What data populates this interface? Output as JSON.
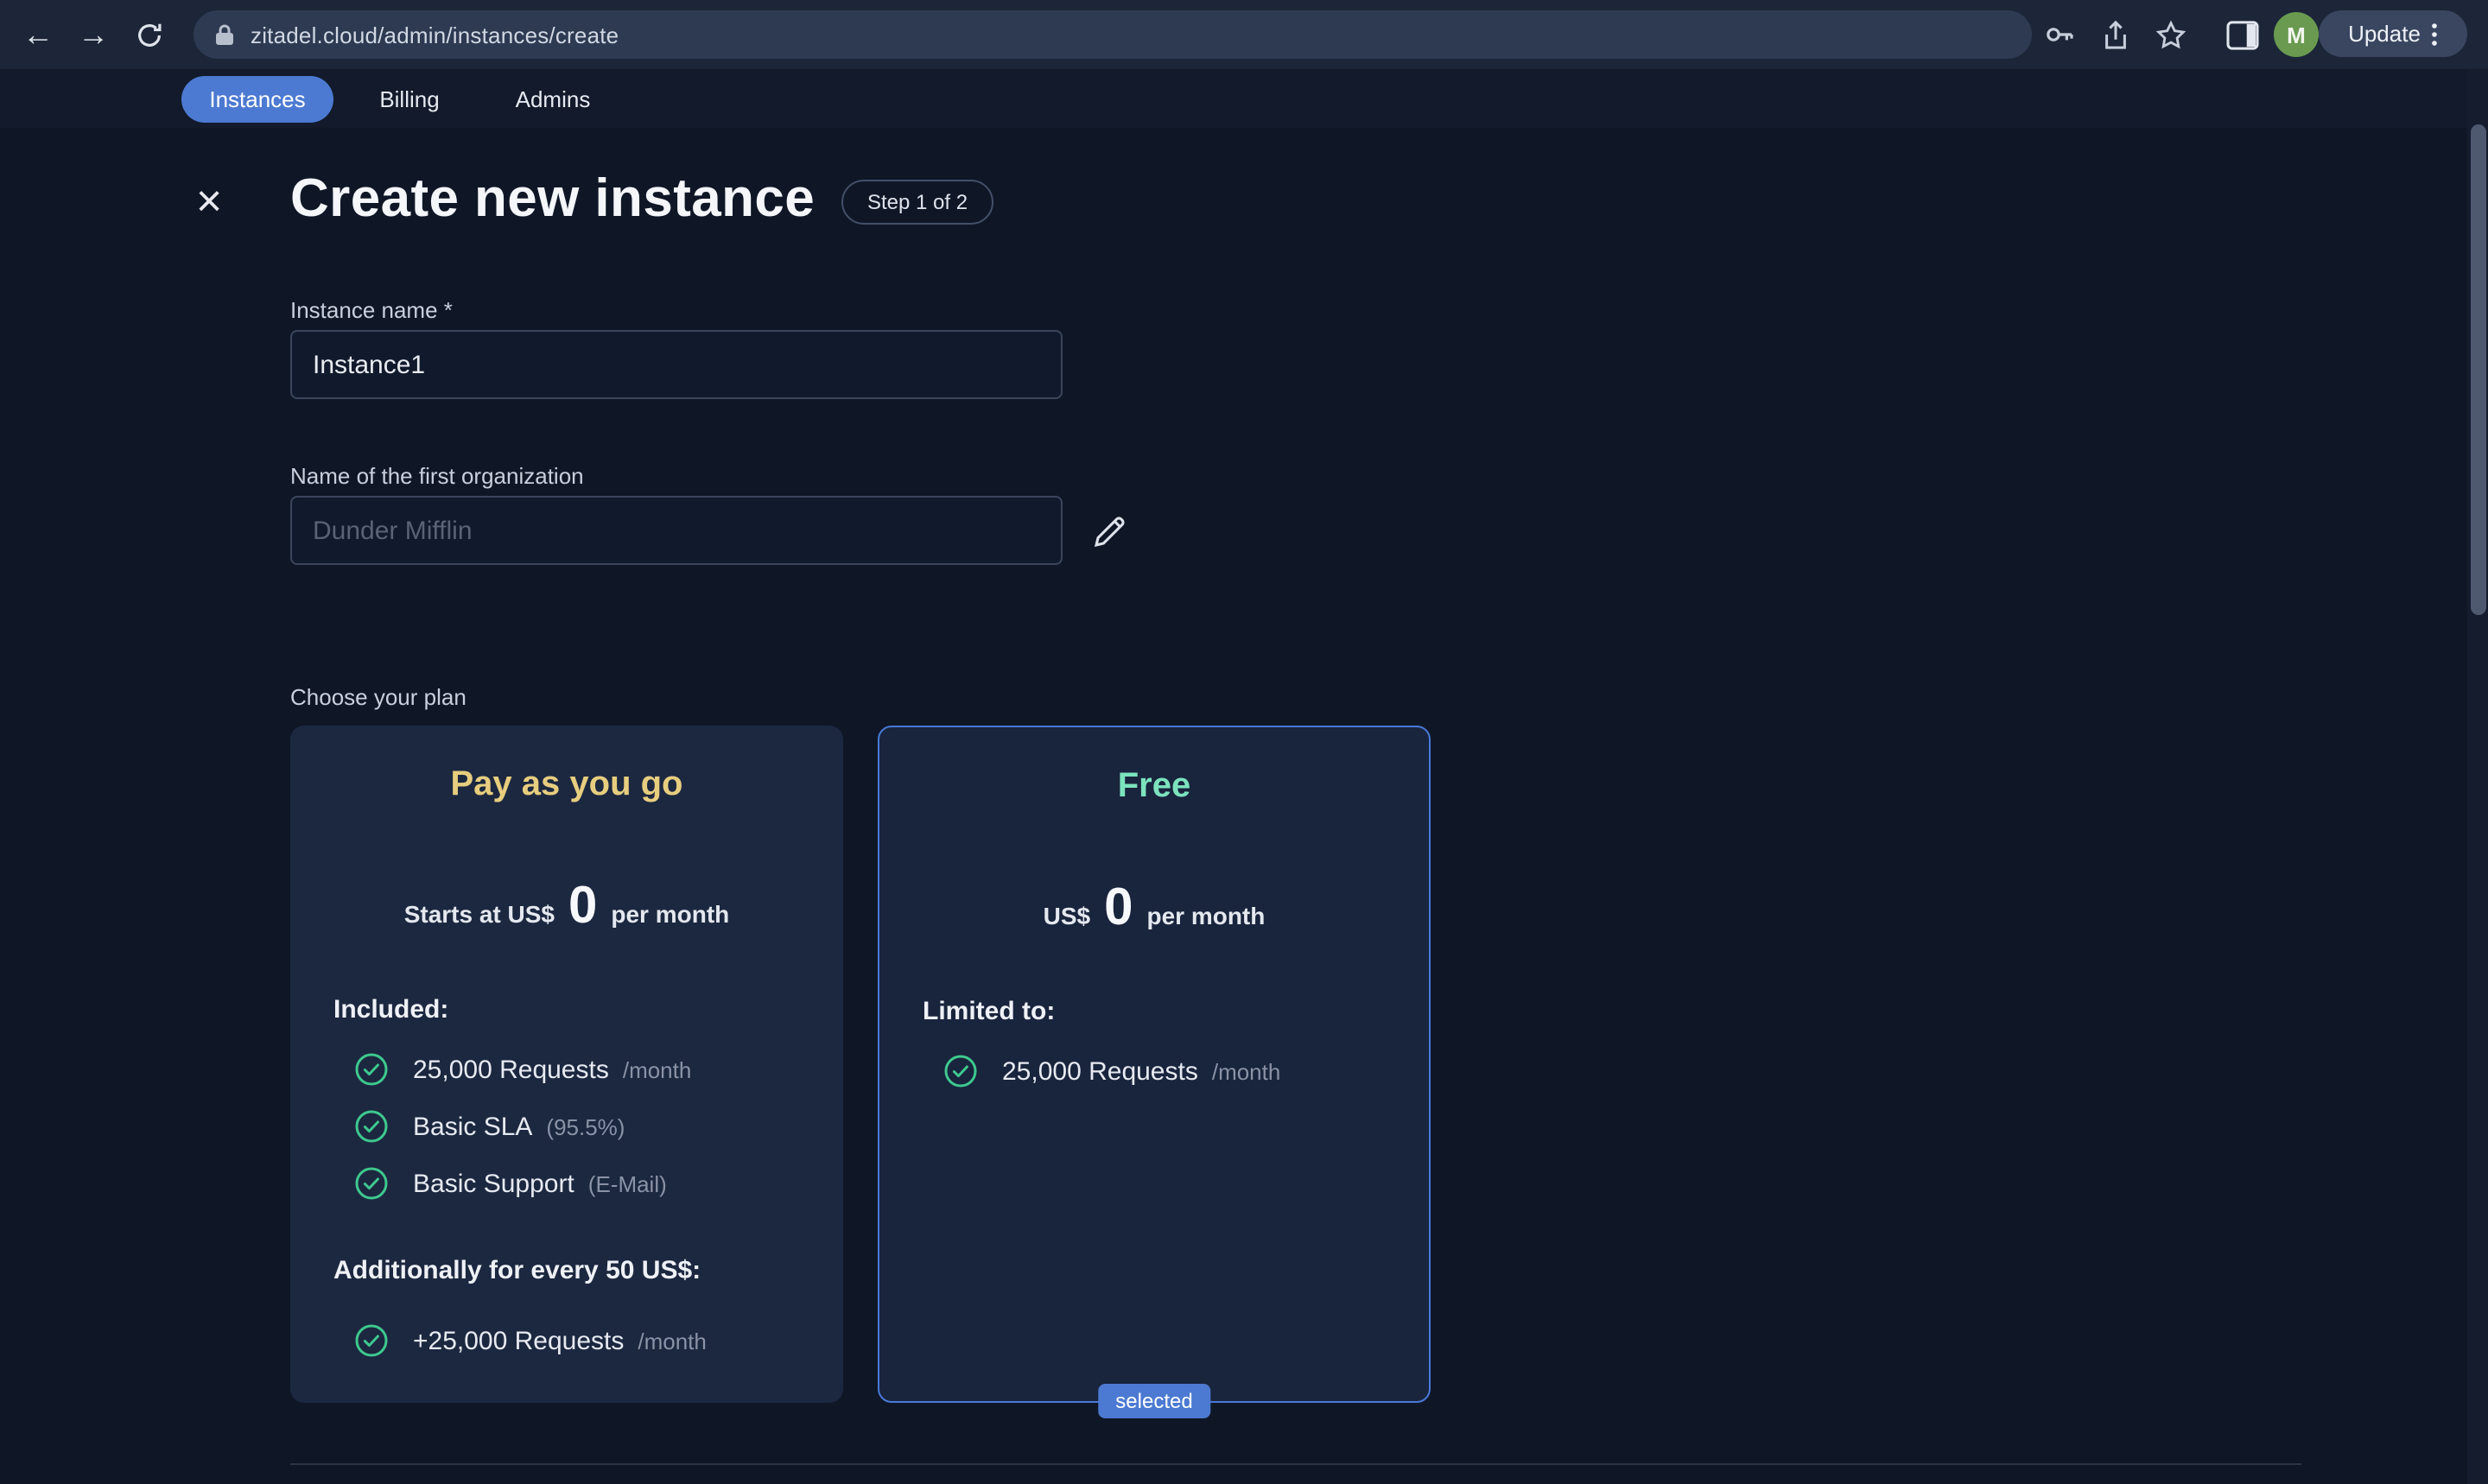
{
  "browser": {
    "url": "zitadel.cloud/admin/instances/create",
    "update_label": "Update",
    "avatar_letter": "M"
  },
  "nav": {
    "tabs": [
      {
        "label": "Instances"
      },
      {
        "label": "Billing"
      },
      {
        "label": "Admins"
      }
    ]
  },
  "page": {
    "title": "Create new instance",
    "step_badge": "Step 1 of 2",
    "fields": {
      "instance_name_label": "Instance name *",
      "instance_name_value": "Instance1",
      "org_label": "Name of the first organization",
      "org_placeholder": "Dunder Mifflin"
    },
    "plans_label": "Choose your plan",
    "plans": [
      {
        "name": "Pay as you go",
        "price_prefix": "Starts at US$",
        "price": "0",
        "price_suffix": "per month",
        "section_title": "Included:",
        "features": [
          {
            "text": "25,000 Requests",
            "note": "/month"
          },
          {
            "text": "Basic SLA",
            "note": "(95.5%)"
          },
          {
            "text": "Basic Support",
            "note": "(E-Mail)"
          }
        ],
        "section2_title": "Additionally for every 50 US$:",
        "features2": [
          {
            "text": "+25,000 Requests",
            "note": "/month"
          }
        ]
      },
      {
        "name": "Free",
        "price_prefix": "US$",
        "price": "0",
        "price_suffix": "per month",
        "section_title": "Limited to:",
        "features": [
          {
            "text": "25,000 Requests",
            "note": "/month"
          }
        ],
        "selected_badge": "selected"
      }
    ],
    "colors": {
      "accent_blue": "#4c7ad2",
      "plan_paygo_title": "#e7cd7e",
      "plan_free_title": "#7ce3bd",
      "check_green": "#3ec98e"
    }
  }
}
